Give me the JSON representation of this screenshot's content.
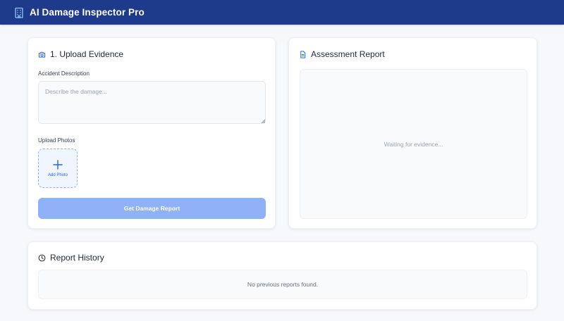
{
  "app": {
    "title": "AI Damage Inspector Pro",
    "logo_icon": "building-icon",
    "header_color": "#1e3a8a"
  },
  "upload": {
    "title": "1. Upload Evidence",
    "icon": "camera-icon",
    "description_label": "Accident Description",
    "description_placeholder": "Describe the damage...",
    "description_value": "",
    "photos_label": "Upload Photos",
    "add_photo_label": "Add Photo",
    "add_photo_icon": "plus-icon",
    "submit_label": "Get Damage Report",
    "submit_color": "#8fb1f7"
  },
  "report": {
    "title": "Assessment Report",
    "icon": "document-icon",
    "status_text": "Waiting for evidence..."
  },
  "history": {
    "title": "Report History",
    "icon": "clock-icon",
    "empty_text": "No previous reports found."
  }
}
